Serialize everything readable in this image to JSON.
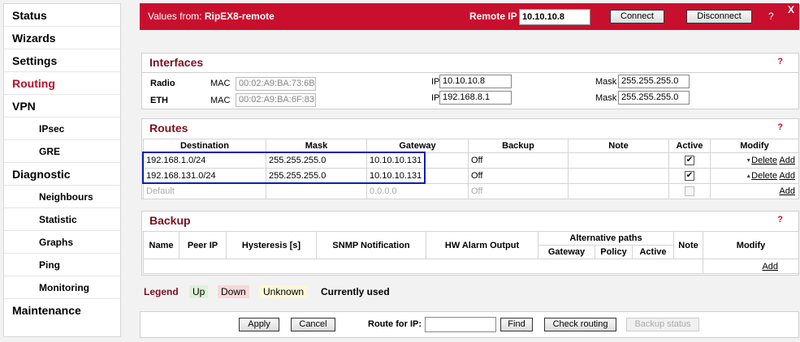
{
  "nav": {
    "status": "Status",
    "wizards": "Wizards",
    "settings": "Settings",
    "routing": "Routing",
    "vpn": "VPN",
    "ipsec": "IPsec",
    "gre": "GRE",
    "diagnostic": "Diagnostic",
    "neighbours": "Neighbours",
    "statistic": "Statistic",
    "graphs": "Graphs",
    "ping": "Ping",
    "monitoring": "Monitoring",
    "maintenance": "Maintenance"
  },
  "topbar": {
    "values_prefix": "Values from: ",
    "remote_name": "RipEX8-remote",
    "remote_ip_label": "Remote IP",
    "remote_ip_value": "10.10.10.8",
    "connect": "Connect",
    "disconnect": "Disconnect",
    "help": "?",
    "close": "X"
  },
  "interfaces": {
    "title": "Interfaces",
    "help": "?",
    "radio": {
      "label": "Radio",
      "mac_label": "MAC",
      "mac": "00:02:A9:BA:73:6B",
      "ip_label": "IP",
      "ip": "10.10.10.8",
      "mask_label": "Mask",
      "mask": "255.255.255.0"
    },
    "eth": {
      "label": "ETH",
      "mac_label": "MAC",
      "mac": "00:02:A9:BA:6F:83",
      "ip_label": "IP",
      "ip": "192.168.8.1",
      "mask_label": "Mask",
      "mask": "255.255.255.0"
    }
  },
  "routes": {
    "title": "Routes",
    "help": "?",
    "headers": {
      "destination": "Destination",
      "mask": "Mask",
      "gateway": "Gateway",
      "backup": "Backup",
      "note": "Note",
      "active": "Active",
      "modify": "Modify"
    },
    "rows": [
      {
        "destination": "192.168.1.0/24",
        "mask": "255.255.255.0",
        "gateway": "10.10.10.131",
        "backup": "Off",
        "note": "",
        "active": "✔",
        "delete": "Delete",
        "add": "Add"
      },
      {
        "destination": "192.168.131.0/24",
        "mask": "255.255.255.0",
        "gateway": "10.10.10.131",
        "backup": "Off",
        "note": "",
        "active": "✔",
        "delete": "Delete",
        "add": "Add"
      }
    ],
    "default_row": {
      "destination": "Default",
      "mask": "",
      "gateway": "0.0.0.0",
      "backup": "Off",
      "add": "Add"
    }
  },
  "backup": {
    "title": "Backup",
    "help": "?",
    "headers": {
      "name": "Name",
      "peer_ip": "Peer IP",
      "hysteresis": "Hysteresis [s]",
      "snmp": "SNMP Notification",
      "hw_alarm": "HW Alarm Output",
      "alt_paths": "Alternative paths",
      "gateway": "Gateway",
      "policy": "Policy",
      "active": "Active",
      "note": "Note",
      "modify": "Modify"
    },
    "add": "Add"
  },
  "legend": {
    "label": "Legend",
    "up": "Up",
    "down": "Down",
    "unknown": "Unknown",
    "current": "Currently used"
  },
  "bottom": {
    "apply": "Apply",
    "cancel": "Cancel",
    "route_for_ip": "Route for IP:",
    "route_ip_value": "",
    "find": "Find",
    "check_routing": "Check routing",
    "backup_status": "Backup status"
  },
  "colors": {
    "brand": "#c8102e",
    "title": "#7a1020",
    "highlight": "#0a1eb4",
    "legend_up": "#dff0d8",
    "legend_down": "#f9d9d9",
    "legend_unknown": "#fbf8d8"
  }
}
